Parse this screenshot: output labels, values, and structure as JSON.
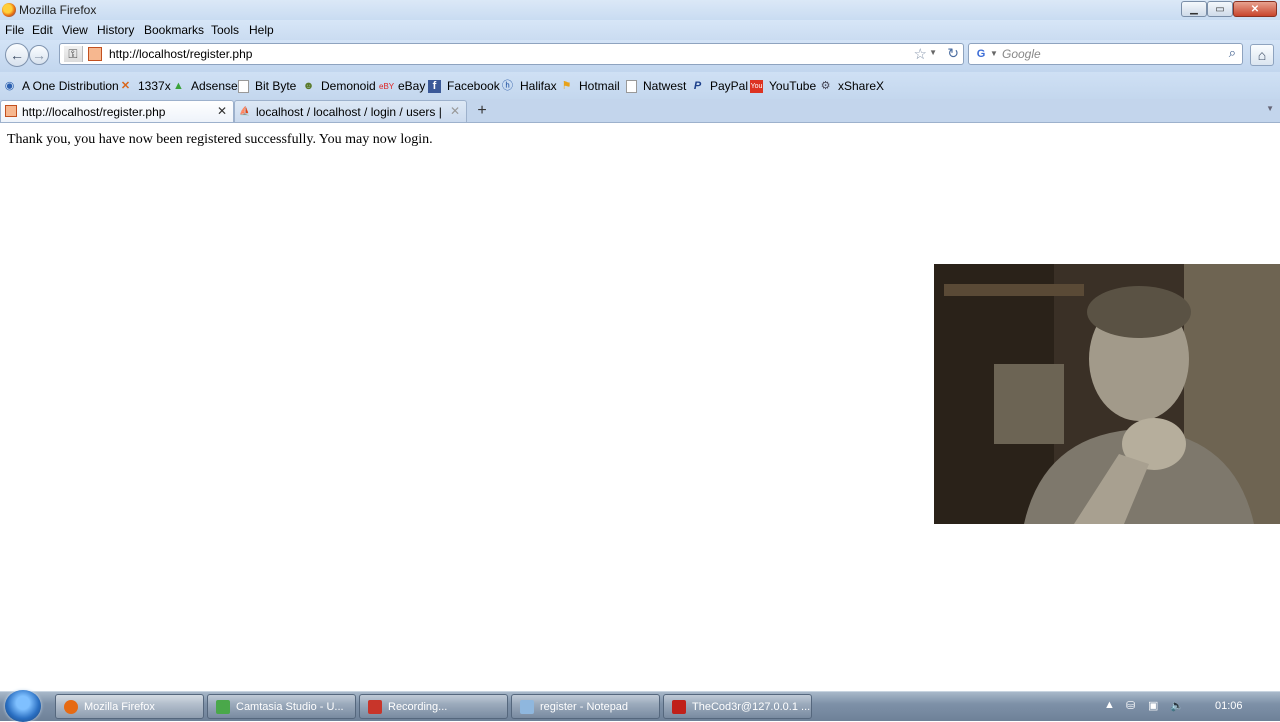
{
  "window": {
    "title": "Mozilla Firefox"
  },
  "menu": [
    "File",
    "Edit",
    "View",
    "History",
    "Bookmarks",
    "Tools",
    "Help"
  ],
  "nav": {
    "url": "http://localhost/register.php",
    "search_placeholder": "Google",
    "search_engine_icon": "google-icon"
  },
  "bookmarks": [
    {
      "label": "A One Distribution",
      "icon": "globe-icon"
    },
    {
      "label": "1337x",
      "icon": "x-icon"
    },
    {
      "label": "Adsense",
      "icon": "adsense-icon"
    },
    {
      "label": "Bit Byte",
      "icon": "page-icon"
    },
    {
      "label": "Demonoid",
      "icon": "demonoid-icon"
    },
    {
      "label": "eBay",
      "icon": "ebay-icon"
    },
    {
      "label": "Facebook",
      "icon": "facebook-icon"
    },
    {
      "label": "Halifax",
      "icon": "halifax-icon"
    },
    {
      "label": "Hotmail",
      "icon": "windows-flag-icon"
    },
    {
      "label": "Natwest",
      "icon": "page-icon"
    },
    {
      "label": "PayPal",
      "icon": "paypal-icon"
    },
    {
      "label": "YouTube",
      "icon": "youtube-icon"
    },
    {
      "label": "xShareX",
      "icon": "xsharex-icon"
    }
  ],
  "tabs": [
    {
      "label": "http://localhost/register.php",
      "active": true
    },
    {
      "label": "localhost / localhost / login / users | ...",
      "active": false
    }
  ],
  "content": {
    "message": "Thank you, you have now been registered successfully. You may now login."
  },
  "taskbar": {
    "tasks": [
      {
        "label": "Mozilla Firefox",
        "icon": "firefox-icon",
        "color": "#e66a12"
      },
      {
        "label": "Camtasia Studio - U...",
        "icon": "camtasia-icon",
        "color": "#4aa84a"
      },
      {
        "label": "Recording...",
        "icon": "recording-icon",
        "color": "#c8352a"
      },
      {
        "label": "register - Notepad",
        "icon": "notepad-icon",
        "color": "#8fb7de"
      },
      {
        "label": "TheCod3r@127.0.0.1 ...",
        "icon": "filezilla-icon",
        "color": "#c0201a"
      }
    ],
    "clock": "01:06"
  },
  "colors": {
    "chrome": "#c9dcf2",
    "taskbar": "#7e91a8"
  }
}
